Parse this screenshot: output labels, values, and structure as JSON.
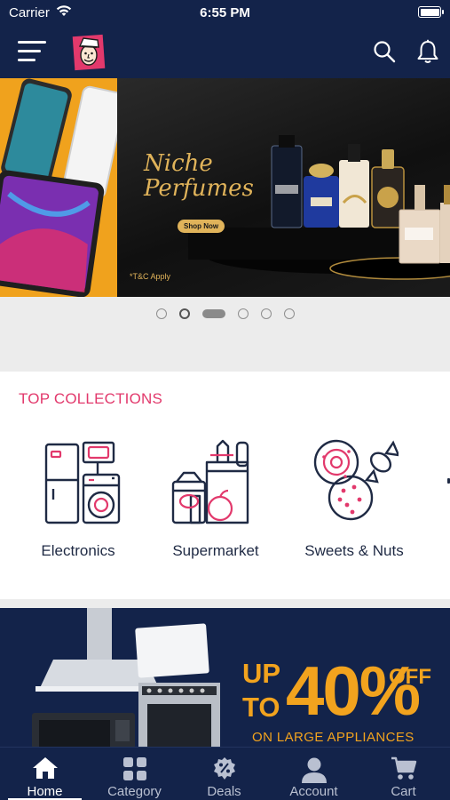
{
  "status_bar": {
    "carrier": "Carrier",
    "time": "6:55 PM"
  },
  "header": {
    "menu_icon": "hamburger-menu-icon",
    "logo_icon": "brand-mascot-logo",
    "search_icon": "search-icon",
    "notifications_icon": "bell-icon"
  },
  "banner": {
    "title_line1": "Niche",
    "title_line2": "Perfumes",
    "cta": "Shop Now",
    "terms": "*T&C Apply",
    "slide_count": 6,
    "active_slide": 3
  },
  "collections": {
    "title": "TOP COLLECTIONS",
    "items": [
      {
        "label": "Electronics",
        "icon": "appliances-icon"
      },
      {
        "label": "Supermarket",
        "icon": "grocery-bag-icon"
      },
      {
        "label": "Sweets & Nuts",
        "icon": "sweets-icon"
      }
    ]
  },
  "promo": {
    "line_up": "UP",
    "line_to": "TO",
    "percent": "40%",
    "off": "OFF",
    "subtitle": "ON LARGE APPLIANCES"
  },
  "tabbar": {
    "tabs": [
      {
        "label": "Home",
        "icon": "home-icon"
      },
      {
        "label": "Category",
        "icon": "grid-icon"
      },
      {
        "label": "Deals",
        "icon": "deals-badge-icon"
      },
      {
        "label": "Account",
        "icon": "user-icon"
      },
      {
        "label": "Cart",
        "icon": "cart-icon"
      }
    ],
    "active": "Home"
  },
  "colors": {
    "navy": "#13234a",
    "accent_pink": "#e2396c",
    "gold": "#e0b35a",
    "promo_orange": "#f2a31e"
  }
}
